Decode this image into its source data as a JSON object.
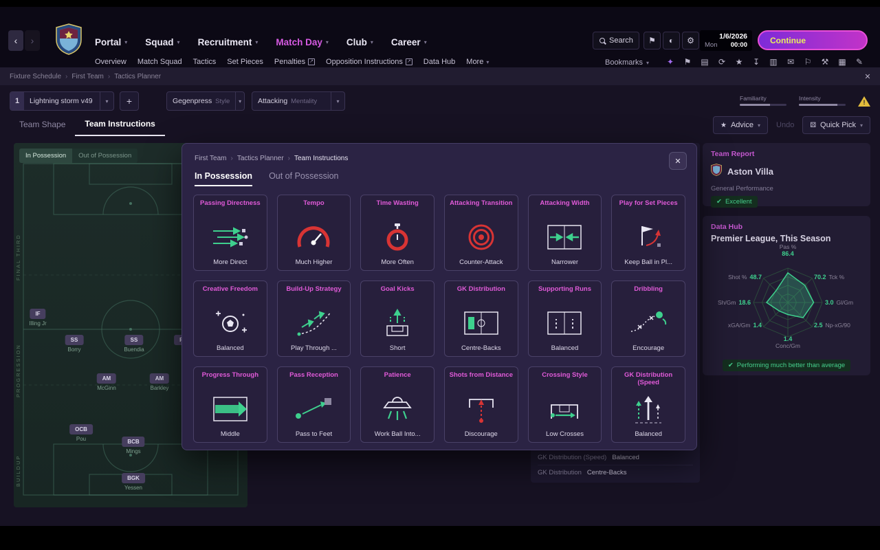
{
  "icons": {
    "caret": "▾",
    "external": "↗",
    "close": "✕",
    "back": "‹",
    "forward": "›",
    "star": "★",
    "undo_glyph": "↺",
    "dice": "⚄",
    "plus": "+",
    "warning": "!",
    "bookmark": "⚑",
    "display": "◐",
    "gear": "⚙",
    "thumb": "✔",
    "crumb_sep": "›"
  },
  "header": {
    "nav": [
      {
        "label": "Portal"
      },
      {
        "label": "Squad"
      },
      {
        "label": "Recruitment"
      },
      {
        "label": "Match Day"
      },
      {
        "label": "Club"
      },
      {
        "label": "Career"
      }
    ],
    "subnav": [
      {
        "label": "Overview"
      },
      {
        "label": "Match Squad"
      },
      {
        "label": "Tactics"
      },
      {
        "label": "Set Pieces"
      },
      {
        "label": "Penalties"
      },
      {
        "label": "Opposition Instructions"
      },
      {
        "label": "Data Hub"
      },
      {
        "label": "More"
      }
    ],
    "search_label": "Search",
    "bookmarks_label": "Bookmarks",
    "date": {
      "date": "1/6/2026",
      "day": "Mon",
      "time": "00:00"
    },
    "continue_label": "Continue",
    "quick_icons": [
      {
        "name": "social-icon",
        "glyph": "✦"
      },
      {
        "name": "club-icon",
        "glyph": "⚑"
      },
      {
        "name": "squad-icon",
        "glyph": "▤"
      },
      {
        "name": "refresh-icon",
        "glyph": "⟳"
      },
      {
        "name": "competition-icon",
        "glyph": "★"
      },
      {
        "name": "transfer-icon",
        "glyph": "↧"
      },
      {
        "name": "report-icon",
        "glyph": "▥"
      },
      {
        "name": "inbox-icon",
        "glyph": "✉"
      },
      {
        "name": "tactics-icon",
        "glyph": "⚐"
      },
      {
        "name": "training-icon",
        "glyph": "⚒"
      },
      {
        "name": "calendar-icon",
        "glyph": "▦"
      },
      {
        "name": "notes-icon",
        "glyph": "✎"
      }
    ]
  },
  "breadcrumb": {
    "a": "Fixture Schedule",
    "b": "First Team",
    "c": "Tactics Planner"
  },
  "tacticbar": {
    "number": "1",
    "name": "Lightning storm v49",
    "style_value": "Gegenpress",
    "style_label": "Style",
    "mentality_value": "Attacking",
    "mentality_label": "Mentality",
    "familiarity_label": "Familiarity",
    "intensity_label": "Intensity"
  },
  "view_tabs": {
    "shape": "Team Shape",
    "instructions": "Team Instructions"
  },
  "actions": {
    "advice": "Advice",
    "undo": "Undo",
    "quick_pick": "Quick Pick"
  },
  "pitch": {
    "tab_in": "In Possession",
    "tab_out": "Out of Possession",
    "zones": [
      {
        "label": "FINAL THIRD"
      },
      {
        "label": "PROGRESSION"
      },
      {
        "label": "BUILDUP"
      }
    ],
    "players": [
      {
        "pos": "IF",
        "name": "Illing Jr"
      },
      {
        "pos": "SS",
        "name": "Borry"
      },
      {
        "pos": "SS",
        "name": "Buendia"
      },
      {
        "pos": "R",
        "name": ""
      },
      {
        "pos": "AM",
        "name": "McGinn"
      },
      {
        "pos": "AM",
        "name": "Barkley"
      },
      {
        "pos": "OCB",
        "name": "Pou"
      },
      {
        "pos": "BCB",
        "name": "Mings"
      },
      {
        "pos": "BGK",
        "name": "Yessen"
      }
    ]
  },
  "behind_list": [
    {
      "label": "GK Distribution (Speed)",
      "value": "Balanced"
    },
    {
      "label": "GK Distribution",
      "value": "Centre-Backs"
    }
  ],
  "modal": {
    "crumb_a": "First Team",
    "crumb_b": "Tactics Planner",
    "crumb_c": "Team Instructions",
    "tab_in": "In Possession",
    "tab_out": "Out of Possession",
    "cards": [
      {
        "title": "Passing Directness",
        "value": "More Direct"
      },
      {
        "title": "Tempo",
        "value": "Much Higher"
      },
      {
        "title": "Time Wasting",
        "value": "More Often"
      },
      {
        "title": "Attacking Transition",
        "value": "Counter-Attack"
      },
      {
        "title": "Attacking Width",
        "value": "Narrower"
      },
      {
        "title": "Play for Set Pieces",
        "value": "Keep Ball in Pl..."
      },
      {
        "title": "Creative Freedom",
        "value": "Balanced"
      },
      {
        "title": "Build-Up Strategy",
        "value": "Play Through ..."
      },
      {
        "title": "Goal Kicks",
        "value": "Short"
      },
      {
        "title": "GK Distribution",
        "value": "Centre-Backs"
      },
      {
        "title": "Supporting Runs",
        "value": "Balanced"
      },
      {
        "title": "Dribbling",
        "value": "Encourage"
      },
      {
        "title": "Progress Through",
        "value": "Middle"
      },
      {
        "title": "Pass Reception",
        "value": "Pass to Feet"
      },
      {
        "title": "Patience",
        "value": "Work Ball Into..."
      },
      {
        "title": "Shots from Distance",
        "value": "Discourage"
      },
      {
        "title": "Crossing Style",
        "value": "Low Crosses"
      },
      {
        "title": "GK Distribution (Speed",
        "value": "Balanced"
      }
    ]
  },
  "sidebar": {
    "team_report": {
      "title": "Team Report",
      "club": "Aston Villa",
      "caption": "General Performance",
      "badge": "Excellent"
    },
    "data_hub": {
      "title": "Data Hub",
      "subtitle": "Premier League, This Season",
      "badge": "Performing much better than average"
    }
  },
  "chart_data": {
    "type": "radar",
    "title": "Premier League, This Season",
    "legend_position": "none",
    "axes": [
      {
        "label": "Pas %",
        "value": 86.4,
        "display": "86.4",
        "max": 100
      },
      {
        "label": "Tck %",
        "value": 70.2,
        "display": "70.2",
        "max": 100
      },
      {
        "label": "Gl/Gm",
        "value": 3.0,
        "display": "3.0",
        "max": 4
      },
      {
        "label": "Np-xG/90",
        "value": 2.5,
        "display": "2.5",
        "max": 4
      },
      {
        "label": "Conc/Gm",
        "value": 1.4,
        "display": "1.4",
        "max": 4
      },
      {
        "label": "xGA/Gm",
        "value": 1.4,
        "display": "1.4",
        "max": 4
      },
      {
        "label": "Sh/Gm",
        "value": 18.6,
        "display": "18.6",
        "max": 30
      },
      {
        "label": "Shot %",
        "value": 48.7,
        "display": "48.7",
        "max": 100
      }
    ],
    "colors": {
      "fill": "rgba(62,208,142,0.28)",
      "stroke": "#3ed08e",
      "web": "#2c4a3c"
    }
  }
}
